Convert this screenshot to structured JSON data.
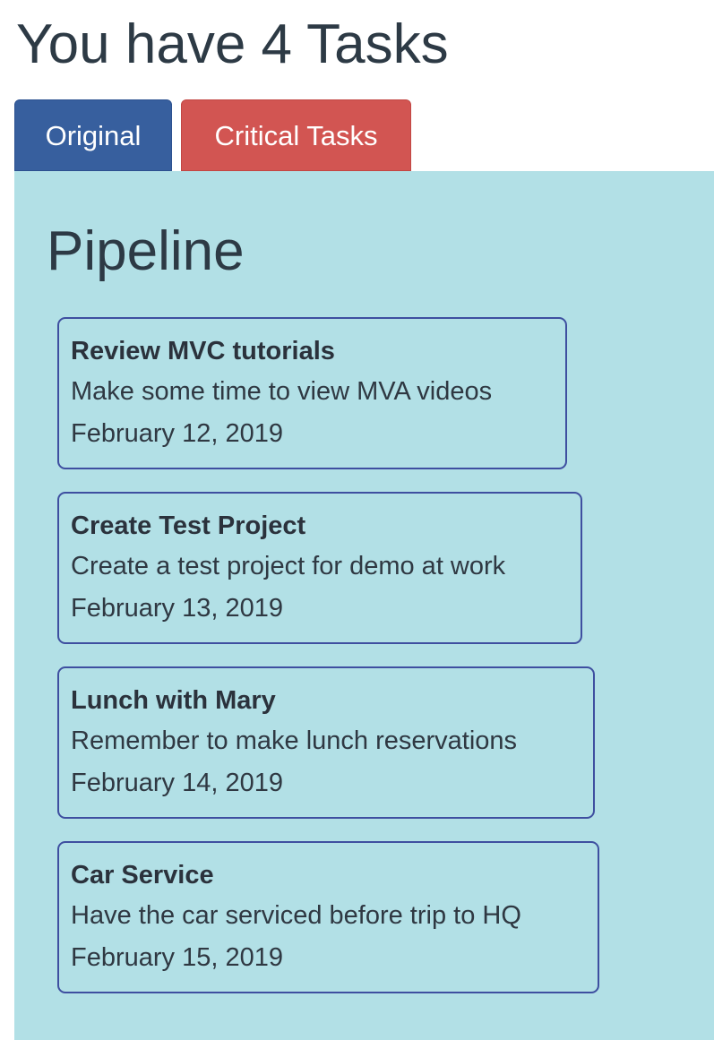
{
  "header": {
    "title": "You have 4 Tasks"
  },
  "tabs": {
    "original_label": "Original",
    "critical_label": "Critical Tasks"
  },
  "colors": {
    "original_tab": "#375f9e",
    "critical_tab": "#d25552",
    "panel_background": "#b2e0e6",
    "card_border": "#3e4fa0"
  },
  "pipeline": {
    "title": "Pipeline",
    "tasks": [
      {
        "title": "Review MVC tutorials",
        "description": "Make some time to view MVA videos",
        "date": "February 12, 2019"
      },
      {
        "title": "Create Test Project",
        "description": "Create a test project for demo at work",
        "date": "February 13, 2019"
      },
      {
        "title": "Lunch with Mary",
        "description": "Remember to make lunch reservations",
        "date": "February 14, 2019"
      },
      {
        "title": "Car Service",
        "description": "Have the car serviced before trip to HQ",
        "date": "February 15, 2019"
      }
    ]
  }
}
